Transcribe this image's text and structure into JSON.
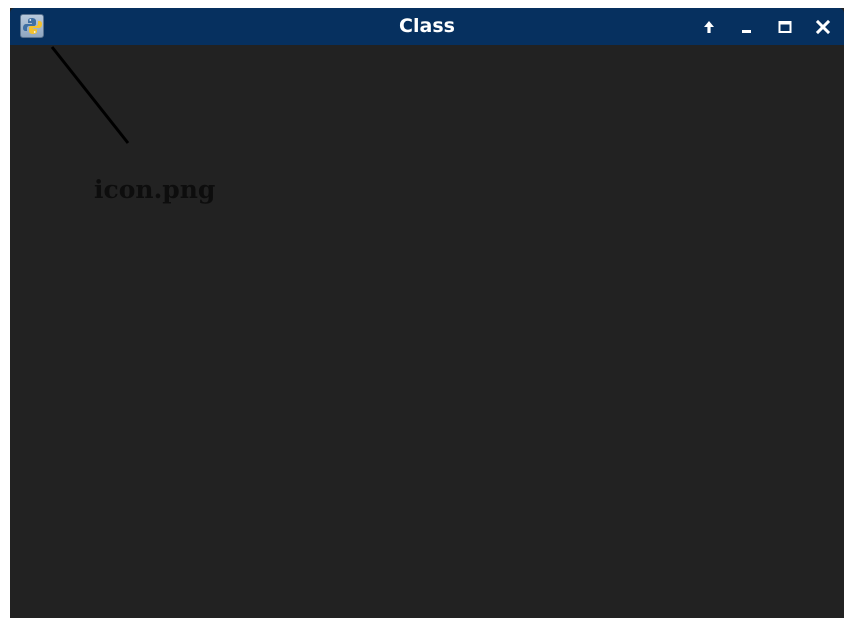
{
  "window": {
    "title": "Class",
    "titlebar_color": "#06305f",
    "background_color": "#222222",
    "app_icon": "python-icon",
    "controls": [
      {
        "name": "shade",
        "icon": "arrow-up-icon"
      },
      {
        "name": "minimize",
        "icon": "minimize-icon"
      },
      {
        "name": "maximize",
        "icon": "maximize-icon"
      },
      {
        "name": "close",
        "icon": "close-icon"
      }
    ]
  },
  "annotation": {
    "label": "icon.png"
  }
}
